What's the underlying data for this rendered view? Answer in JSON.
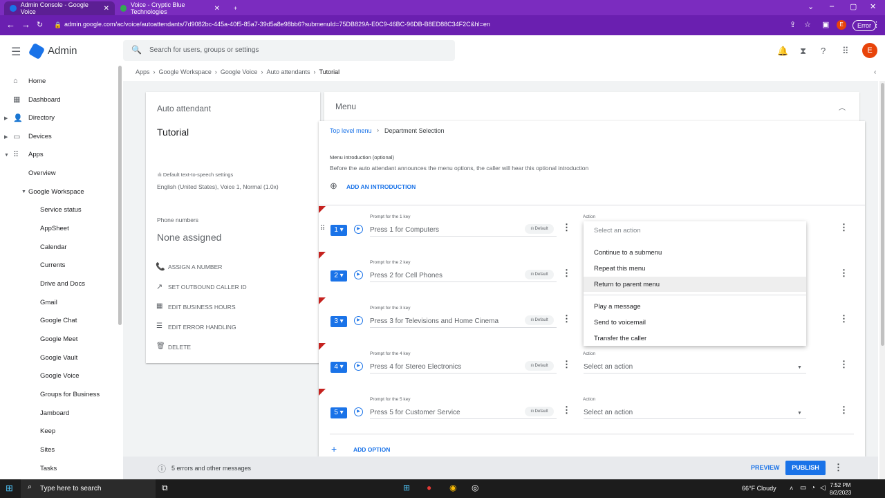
{
  "browser": {
    "tabs": [
      {
        "label": "Admin Console - Google Voice",
        "active": true
      },
      {
        "label": "Voice - Cryptic Blue Technologies",
        "active": false
      }
    ],
    "new_tab": "+",
    "url": "admin.google.com/ac/voice/autoattendants/7d9082bc-445a-40f5-85a7-39d5a8e98bb6?submenuId=75DB829A-E0C9-46BC-96DB-B8ED88C34F2C&hl=en",
    "profile": "E",
    "error_pill": "Error"
  },
  "header": {
    "app_name": "Admin",
    "search_placeholder": "Search for users, groups or settings",
    "avatar": "E"
  },
  "sidebar": {
    "items": [
      {
        "label": "Home"
      },
      {
        "label": "Dashboard"
      },
      {
        "label": "Directory"
      },
      {
        "label": "Devices"
      },
      {
        "label": "Apps"
      },
      {
        "label": "Overview"
      },
      {
        "label": "Google Workspace"
      },
      {
        "label": "Service status"
      },
      {
        "label": "AppSheet"
      },
      {
        "label": "Calendar"
      },
      {
        "label": "Currents"
      },
      {
        "label": "Drive and Docs"
      },
      {
        "label": "Gmail"
      },
      {
        "label": "Google Chat"
      },
      {
        "label": "Google Meet"
      },
      {
        "label": "Google Vault"
      },
      {
        "label": "Google Voice"
      },
      {
        "label": "Groups for Business"
      },
      {
        "label": "Jamboard"
      },
      {
        "label": "Keep"
      },
      {
        "label": "Sites"
      },
      {
        "label": "Tasks"
      }
    ]
  },
  "breadcrumb": [
    "Apps",
    "Google Workspace",
    "Google Voice",
    "Auto attendants",
    "Tutorial"
  ],
  "left_card": {
    "section": "Auto attendant",
    "title": "Tutorial",
    "tts_label": "Default text-to-speech settings",
    "tts_value": "English (United States), Voice 1, Normal (1.0x)",
    "phone_label": "Phone numbers",
    "phone_value": "None assigned",
    "actions": [
      "ASSIGN A NUMBER",
      "SET OUTBOUND CALLER ID",
      "EDIT BUSINESS HOURS",
      "EDIT ERROR HANDLING",
      "DELETE"
    ]
  },
  "menu": {
    "header": "Menu",
    "crumb_top": "Top level menu",
    "crumb_current": "Department Selection",
    "intro_label": "Menu introduction (optional)",
    "intro_desc": "Before the auto attendant announces the menu options, the caller will hear this optional introduction",
    "add_intro": "ADD AN INTRODUCTION",
    "action_label": "Action",
    "select_placeholder": "Select an action",
    "default_badge": "Default",
    "options": [
      {
        "key": "1",
        "prompt_label": "Prompt for the 1 key",
        "prompt": "Press 1 for Computers"
      },
      {
        "key": "2",
        "prompt_label": "Prompt for the 2 key",
        "prompt": "Press 2 for Cell Phones"
      },
      {
        "key": "3",
        "prompt_label": "Prompt for the 3 key",
        "prompt": "Press 3 for Televisions and Home Cinema"
      },
      {
        "key": "4",
        "prompt_label": "Prompt for the 4 key",
        "prompt": "Press 4 for Stereo Electronics"
      },
      {
        "key": "5",
        "prompt_label": "Prompt for the 5 key",
        "prompt": "Press 5 for Customer Service"
      }
    ],
    "add_option": "ADD OPTION",
    "dropdown_options": [
      "Continue to a submenu",
      "Repeat this menu",
      "Return to parent menu",
      "Play a message",
      "Send to voicemail",
      "Transfer the caller"
    ]
  },
  "footer": {
    "message": "5 errors and other messages",
    "preview": "PREVIEW",
    "publish": "PUBLISH"
  },
  "taskbar": {
    "search": "Type here to search",
    "weather": "66°F  Cloudy",
    "time": "7:52 PM",
    "date": "8/2/2023"
  }
}
